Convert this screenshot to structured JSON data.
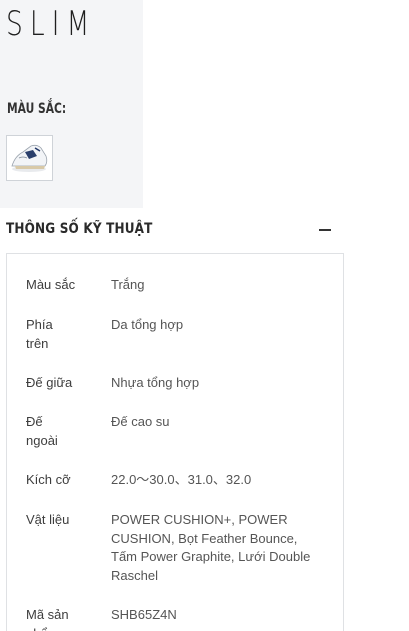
{
  "product": {
    "title": "SLIM"
  },
  "colors": {
    "label": "MÀU SẮC:",
    "selected_swatch": "white-shoe-swatch"
  },
  "specs": {
    "title": "THÔNG SỐ KỸ THUẬT",
    "toggle_icon": "minus-icon",
    "rows": [
      {
        "key": "Màu sắc",
        "value": "Trắng"
      },
      {
        "key": "Phía trên",
        "value": "Da tổng hợp"
      },
      {
        "key": "Đế giữa",
        "value": "Nhựa tổng hợp"
      },
      {
        "key": "Đế ngoài",
        "value": "Đế cao su"
      },
      {
        "key": "Kích cỡ",
        "value": "22.0～30.0、31.0、32.0"
      },
      {
        "key": "Vật liệu",
        "value": "POWER CUSHION+, POWER CUSHION, Bọt Feather Bounce, Tấm Power Graphite, Lưới Double Raschel"
      },
      {
        "key": "Mã sản phẩm",
        "value": "SHB65Z4N"
      }
    ]
  }
}
